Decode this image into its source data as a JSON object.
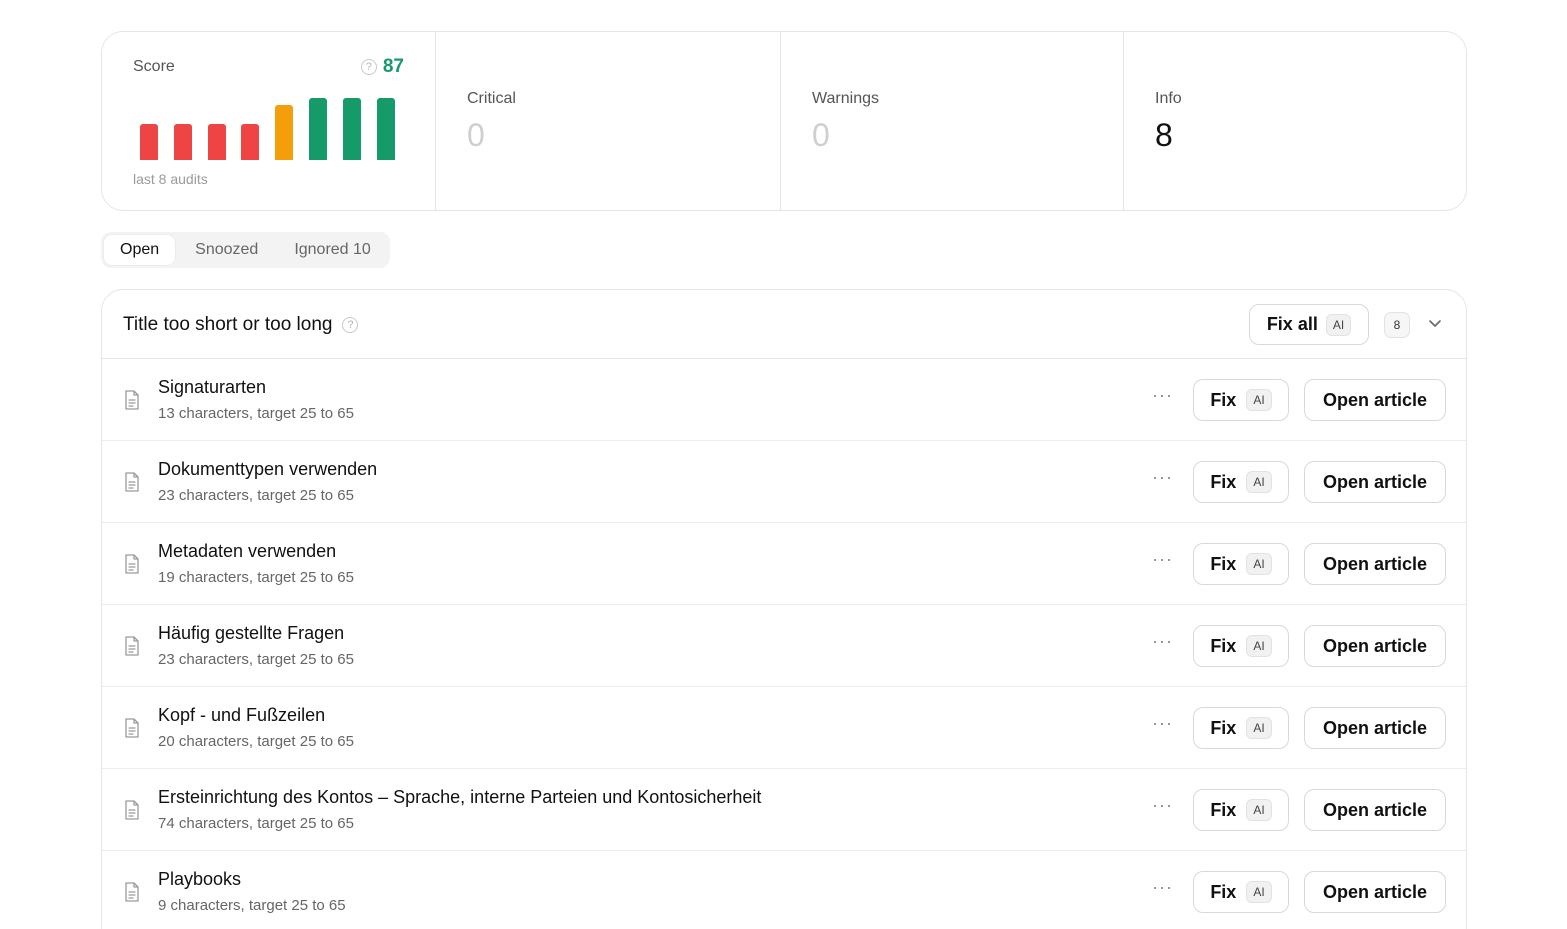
{
  "score": {
    "label": "Score",
    "value": "87",
    "audits_label": "last 8 audits",
    "chart_data": {
      "type": "bar",
      "values": [
        1,
        1,
        1,
        1,
        1.5,
        1.7,
        1.7,
        1.7
      ],
      "colors": [
        "#ee4444",
        "#ee4444",
        "#ee4444",
        "#ee4444",
        "#f59e0b",
        "#159a6a",
        "#159a6a",
        "#159a6a"
      ]
    }
  },
  "critical": {
    "label": "Critical",
    "value": "0"
  },
  "warnings": {
    "label": "Warnings",
    "value": "0"
  },
  "info": {
    "label": "Info",
    "value": "8"
  },
  "tabs": [
    {
      "label": "Open",
      "active": true
    },
    {
      "label": "Snoozed",
      "active": false
    },
    {
      "label": "Ignored 10",
      "active": false
    }
  ],
  "issue_group": {
    "title": "Title too short or too long",
    "fix_all_label": "Fix all",
    "ai_label": "AI",
    "count": "8"
  },
  "row_actions": {
    "fix_label": "Fix",
    "ai_label": "AI",
    "open_label": "Open article",
    "more": "···"
  },
  "rows": [
    {
      "title": "Signaturarten",
      "subtitle": "13 characters, target 25 to 65"
    },
    {
      "title": "Dokumenttypen verwenden",
      "subtitle": "23 characters, target 25 to 65"
    },
    {
      "title": "Metadaten verwenden",
      "subtitle": "19 characters, target 25 to 65"
    },
    {
      "title": "Häufig gestellte Fragen",
      "subtitle": "23 characters, target 25 to 65"
    },
    {
      "title": "Kopf - und Fußzeilen",
      "subtitle": "20 characters, target 25 to 65"
    },
    {
      "title": "Ersteinrichtung des Kontos – Sprache, interne Parteien und Kontosicherheit",
      "subtitle": "74 characters, target 25 to 65"
    },
    {
      "title": "Playbooks",
      "subtitle": "9 characters, target 25 to 65"
    }
  ],
  "colors": {
    "score_green": "#159a6a",
    "accent_text": "#111111"
  }
}
